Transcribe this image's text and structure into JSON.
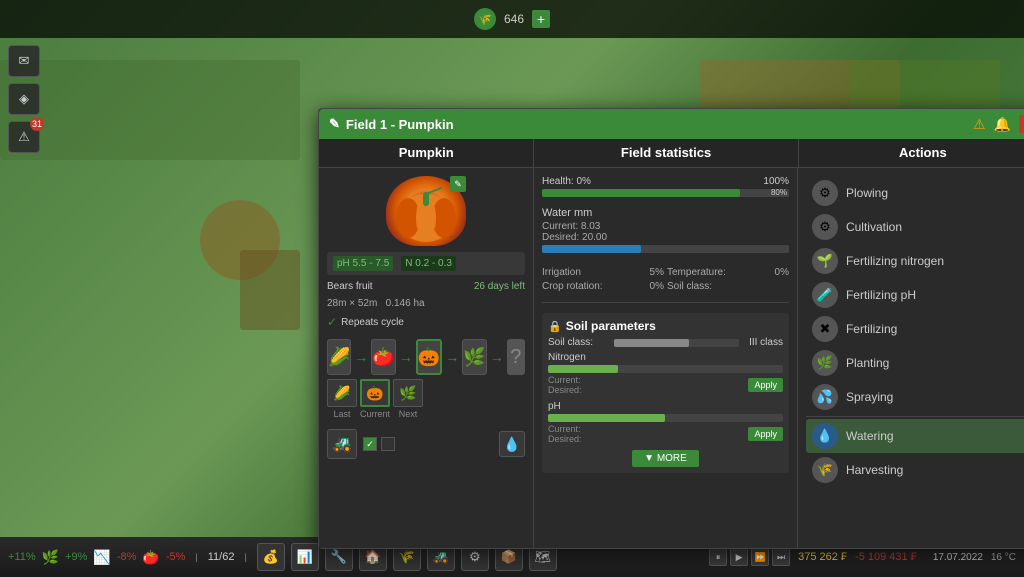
{
  "window": {
    "title": "Field 1 - Pumpkin",
    "close_label": "✕",
    "bell_label": "🔔",
    "warning_label": "⚠"
  },
  "top_bar": {
    "resource_count": "646",
    "add_label": "+"
  },
  "left_panel": {
    "title": "Pumpkin",
    "edit_label": "✎",
    "ph_label": "pH 5.5 - 7.5",
    "n_label": "N 0.2 - 0.3",
    "bears_fruit": "Bears fruit",
    "days_left": "26 days left",
    "dimensions": "28m × 52m",
    "area": "0.146 ha",
    "repeat_cycle": "Repeats cycle",
    "rotation_labels": {
      "last": "Last",
      "current": "Current",
      "next": "Next"
    }
  },
  "middle_panel": {
    "title": "Field statistics",
    "health": {
      "label_start": "Health: 0%",
      "label_end": "100%",
      "bar_label": "80%",
      "value": 80
    },
    "water": {
      "title": "Water mm",
      "current_label": "Current:",
      "current_value": "8.03",
      "desired_label": "Desired:",
      "desired_value": "20.00",
      "bar_value": 40
    },
    "stats": [
      {
        "label": "Irrigation",
        "value": "5%"
      },
      {
        "label": "Temperature:",
        "value": "0%"
      },
      {
        "label": "Crop rotation:",
        "value": "0%"
      },
      {
        "label": "Soil class:",
        "value": ""
      }
    ],
    "soil": {
      "title": "Soil parameters",
      "soil_class_label": "Soil class:",
      "soil_class_value": "III class",
      "nitrogen": {
        "label": "Nitrogen",
        "current_label": "Current:",
        "desired_label": "Desired:",
        "apply_label": "Apply"
      },
      "ph": {
        "label": "pH",
        "current_label": "Current:",
        "desired_label": "Desired:",
        "apply_label": "Apply"
      },
      "more_label": "▼ MORE"
    }
  },
  "right_panel": {
    "title": "Actions",
    "actions": [
      {
        "id": "plowing",
        "label": "Plowing",
        "icon": "🔧"
      },
      {
        "id": "cultivation",
        "label": "Cultivation",
        "icon": "🔧"
      },
      {
        "id": "fertilizing_n",
        "label": "Fertilizing nitrogen",
        "icon": "🌱"
      },
      {
        "id": "fertilizing_ph",
        "label": "Fertilizing pH",
        "icon": "🧪"
      },
      {
        "id": "fertilizing",
        "label": "Fertilizing",
        "icon": "💧"
      },
      {
        "id": "planting",
        "label": "Planting",
        "icon": "🌿"
      },
      {
        "id": "spraying",
        "label": "Spraying",
        "icon": "💦"
      },
      {
        "id": "watering",
        "label": "Watering",
        "icon": "💧",
        "active": true
      },
      {
        "id": "harvesting",
        "label": "Harvesting",
        "icon": "🌾"
      }
    ]
  },
  "bottom_bar": {
    "stats": [
      {
        "label": "+11%",
        "color": "green"
      },
      {
        "label": "+9%",
        "color": "green"
      },
      {
        "label": "-8%",
        "color": "red"
      },
      {
        "label": "-5%",
        "color": "red"
      }
    ],
    "field_count": "11/62",
    "money": "375 262 ₣",
    "debt": "-5 109 431 ₣",
    "date": "17.07.2022",
    "temp": "16 °C"
  }
}
